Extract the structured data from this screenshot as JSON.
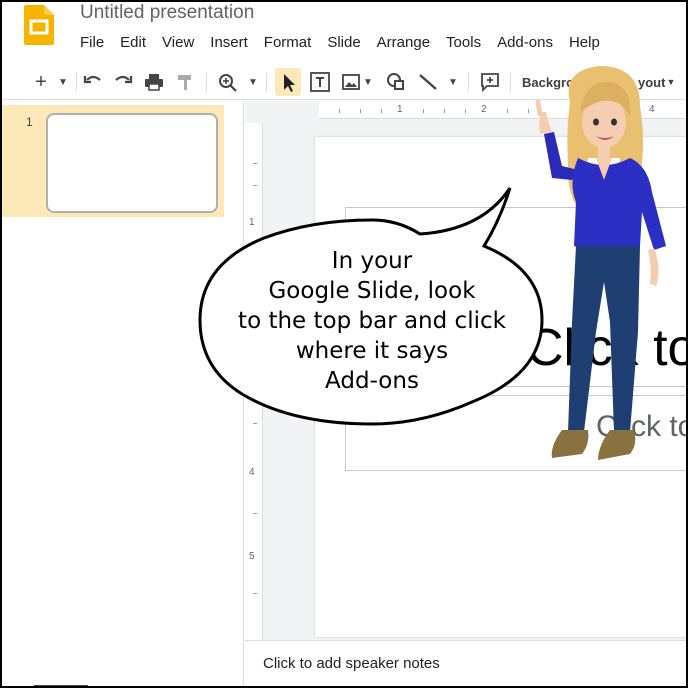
{
  "app": {
    "title": "Untitled presentation",
    "logo_icon": "slides-logo-icon",
    "accent_color": "#f4b400"
  },
  "menu": [
    {
      "label": "File"
    },
    {
      "label": "Edit"
    },
    {
      "label": "View"
    },
    {
      "label": "Insert"
    },
    {
      "label": "Format"
    },
    {
      "label": "Slide"
    },
    {
      "label": "Arrange"
    },
    {
      "label": "Tools"
    },
    {
      "label": "Add-ons"
    },
    {
      "label": "Help"
    }
  ],
  "toolbar": {
    "background_label": "Backgro",
    "layout_label": "yout",
    "icons": [
      "new-slide-icon",
      "dropdown-icon",
      "undo-icon",
      "redo-icon",
      "print-icon",
      "paint-format-icon",
      "zoom-icon",
      "select-cursor-icon",
      "text-box-icon",
      "image-icon",
      "shape-icon",
      "line-icon",
      "comment-icon"
    ]
  },
  "filmstrip": {
    "slides": [
      {
        "number": "1"
      }
    ]
  },
  "rulers": {
    "horizontal": [
      "1",
      "2",
      "4"
    ],
    "vertical": [
      "1",
      "4",
      "5"
    ]
  },
  "slide": {
    "title_placeholder": "Click to",
    "subtitle_placeholder": "Click to"
  },
  "notes": {
    "placeholder": "Click to add speaker notes"
  },
  "speech_bubble": {
    "lines": [
      "In your",
      "Google Slide, look",
      "to the top bar and click",
      "where it says",
      "Add-ons"
    ]
  }
}
